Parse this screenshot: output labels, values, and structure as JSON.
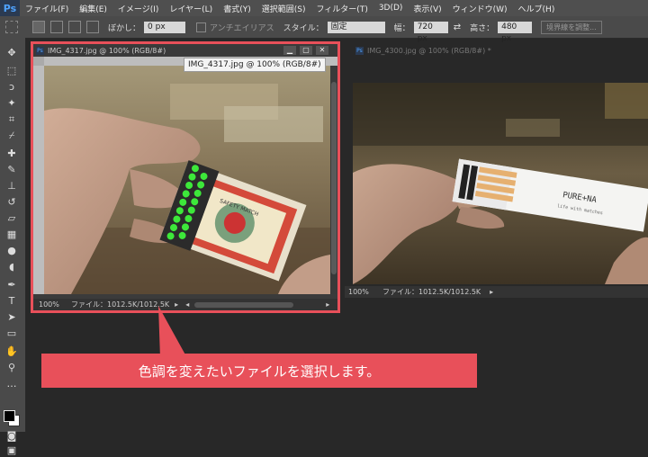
{
  "menubar": {
    "logo": "Ps",
    "items": [
      "ファイル(F)",
      "編集(E)",
      "イメージ(I)",
      "レイヤー(L)",
      "書式(Y)",
      "選択範囲(S)",
      "フィルター(T)",
      "3D(D)",
      "表示(V)",
      "ウィンドウ(W)",
      "ヘルプ(H)"
    ]
  },
  "options": {
    "feather_label": "ぼかし：",
    "feather_value": "0 px",
    "antialias_label": "アンチエイリアス",
    "style_label": "スタイル：",
    "style_value": "固定",
    "width_label": "幅：",
    "width_value": "720 px",
    "height_label": "高さ：",
    "height_value": "480 px",
    "refine_button": "境界線を調整..."
  },
  "doc_left": {
    "title": "IMG_4317.jpg @ 100% (RGB/8#)",
    "tooltip": "IMG_4317.jpg @ 100% (RGB/8#)",
    "zoom": "100%",
    "file_info": "ファイル：1012.5K/1012.5K",
    "label_box": "SAFETY MATCH"
  },
  "doc_right": {
    "title": "IMG_4300.jpg @ 100% (RGB/8#) *",
    "zoom": "100%",
    "file_info": "ファイル：1012.5K/1012.5K",
    "box_text": "PURE+NA",
    "box_subtext": "life with matches"
  },
  "callout": {
    "text": "色調を変えたいファイルを選択します。"
  },
  "colors": {
    "accent": "#e8505a",
    "ui_dark": "#282828",
    "panel": "#4a4a4a"
  }
}
